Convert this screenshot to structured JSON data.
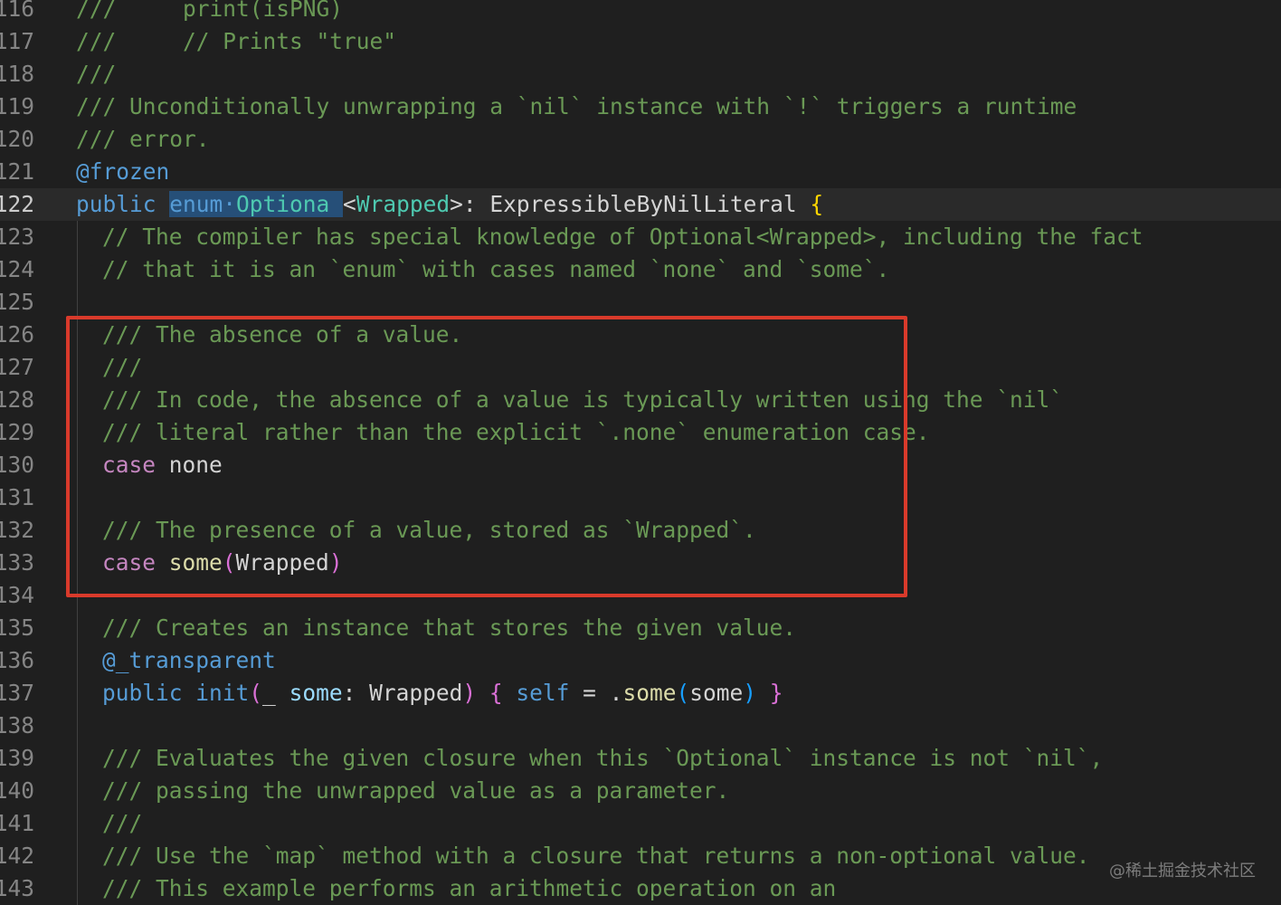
{
  "colors": {
    "background": "#1f1f1f",
    "comment": "#6a9955",
    "keyword": "#569cd6",
    "control_keyword": "#c586c0",
    "type": "#4ec9b0",
    "function": "#dcdcaa",
    "annotation_box": "#d93a2b"
  },
  "annotation": {
    "shape": "red rectangle",
    "covers_lines": [
      "126",
      "133"
    ]
  },
  "watermark": "@稀土掘金技术社区",
  "lines": [
    {
      "num": "116",
      "text": "///     print(isPNG)"
    },
    {
      "num": "117",
      "text": "///     // Prints \"true\""
    },
    {
      "num": "118",
      "text": "///"
    },
    {
      "num": "119",
      "text": "/// Unconditionally unwrapping a `nil` instance with `!` triggers a runtime"
    },
    {
      "num": "120",
      "text": "/// error."
    },
    {
      "num": "121",
      "text": "@frozen"
    },
    {
      "num": "122",
      "text": "public enum Optiona <Wrapped>: ExpressibleByNilLiteral {",
      "current": true
    },
    {
      "num": "123",
      "text": "// The compiler has special knowledge of Optional<Wrapped>, including the fact"
    },
    {
      "num": "124",
      "text": "// that it is an `enum` with cases named `none` and `some`."
    },
    {
      "num": "125",
      "text": ""
    },
    {
      "num": "126",
      "text": "/// The absence of a value."
    },
    {
      "num": "127",
      "text": "///"
    },
    {
      "num": "128",
      "text": "/// In code, the absence of a value is typically written using the `nil`"
    },
    {
      "num": "129",
      "text": "/// literal rather than the explicit `.none` enumeration case."
    },
    {
      "num": "130",
      "text": "case none"
    },
    {
      "num": "131",
      "text": ""
    },
    {
      "num": "132",
      "text": "/// The presence of a value, stored as `Wrapped`."
    },
    {
      "num": "133",
      "text": "case some(Wrapped)"
    },
    {
      "num": "134",
      "text": ""
    },
    {
      "num": "135",
      "text": "/// Creates an instance that stores the given value."
    },
    {
      "num": "136",
      "text": "@_transparent"
    },
    {
      "num": "137",
      "text": "public init(_ some: Wrapped) { self = .some(some) }"
    },
    {
      "num": "138",
      "text": ""
    },
    {
      "num": "139",
      "text": "/// Evaluates the given closure when this `Optional` instance is not `nil`,"
    },
    {
      "num": "140",
      "text": "/// passing the unwrapped value as a parameter."
    },
    {
      "num": "141",
      "text": "///"
    },
    {
      "num": "142",
      "text": "/// Use the `map` method with a closure that returns a non-optional value."
    },
    {
      "num": "143",
      "text": "/// This example performs an arithmetic operation on an"
    }
  ]
}
